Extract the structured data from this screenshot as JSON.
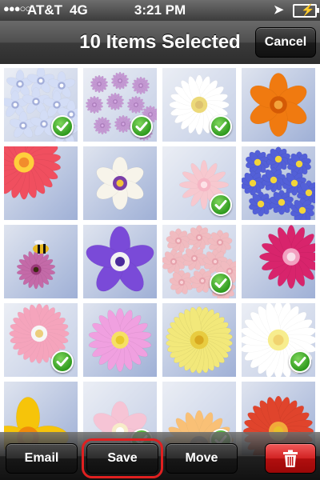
{
  "status_bar": {
    "signal": "●●●○○",
    "carrier": "AT&T",
    "network": "4G",
    "time": "3:21 PM",
    "location_icon": "location-arrow-icon",
    "battery_icon": "battery-charging-icon"
  },
  "nav": {
    "title": "10 Items Selected",
    "cancel_label": "Cancel"
  },
  "photos": [
    {
      "name": "blue-hydrangea",
      "selected": true
    },
    {
      "name": "purple-allium",
      "selected": true
    },
    {
      "name": "white-daisy",
      "selected": true
    },
    {
      "name": "orange-flower",
      "selected": false
    },
    {
      "name": "pink-gerbera",
      "selected": false
    },
    {
      "name": "white-iris",
      "selected": false
    },
    {
      "name": "pink-camellia",
      "selected": true
    },
    {
      "name": "blue-asters",
      "selected": false
    },
    {
      "name": "bee-on-thistle",
      "selected": false
    },
    {
      "name": "purple-petunia",
      "selected": false
    },
    {
      "name": "pink-roses",
      "selected": true
    },
    {
      "name": "magenta-daisies",
      "selected": false
    },
    {
      "name": "pink-gerbera-2",
      "selected": true
    },
    {
      "name": "pink-dahlia",
      "selected": false
    },
    {
      "name": "yellow-chrysanthemum",
      "selected": false
    },
    {
      "name": "white-gerbera",
      "selected": true
    },
    {
      "name": "yellow-petals",
      "selected": false
    },
    {
      "name": "pink-bloom",
      "selected": true
    },
    {
      "name": "orange-gazania",
      "selected": true
    },
    {
      "name": "red-dahlia",
      "selected": false
    }
  ],
  "toolbar": {
    "email_label": "Email",
    "save_label": "Save",
    "move_label": "Move",
    "delete_icon": "trash-icon"
  },
  "colors": {
    "check_green": "#3aa825",
    "delete_red": "#d12222",
    "highlight_red": "#e02020"
  }
}
